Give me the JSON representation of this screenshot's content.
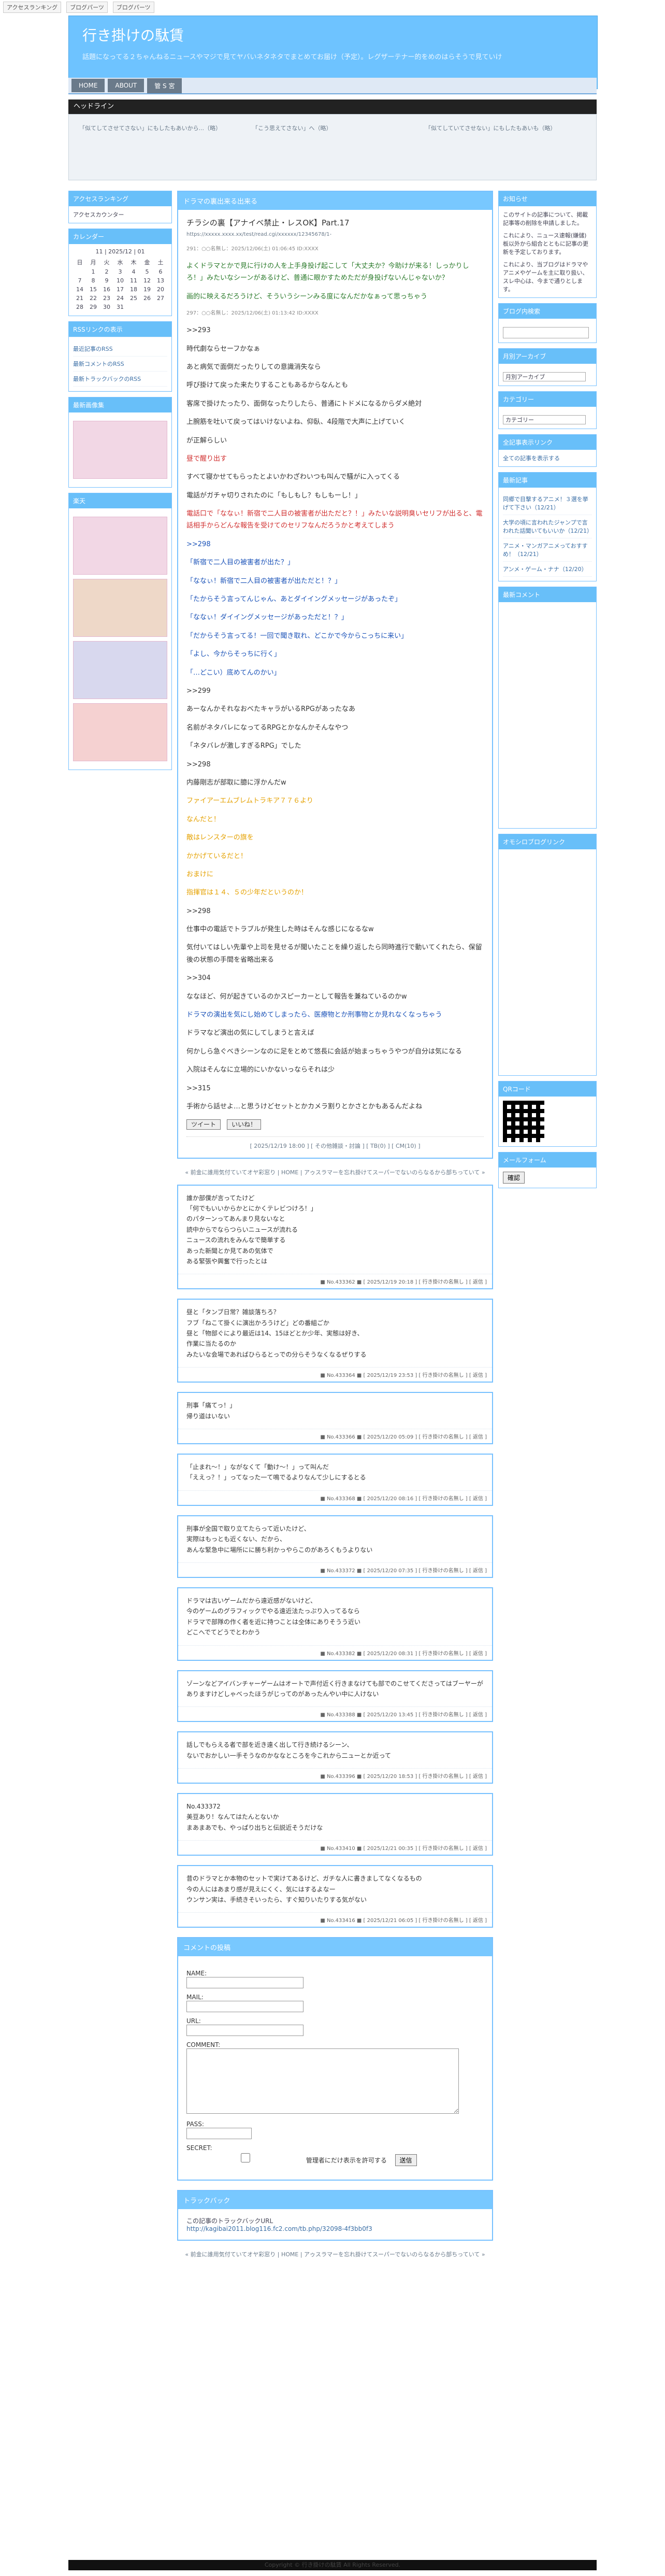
{
  "topbar": {
    "a": "アクセスランキング",
    "b": "ブログパーツ",
    "c": "ブログパーツ"
  },
  "site": {
    "title": "行き掛けの駄賃",
    "desc": "話題になってる２ちゃんねるニュースやマジで見てヤバいネタネタでまとめてお届け（予定）。レグザーテナー的をめのはらそうで見ていけ"
  },
  "nav": {
    "home": "HOME",
    "about": "ABOUT",
    "admin": "管 S 宮"
  },
  "headline": {
    "title": "ヘッドライン",
    "col1": "「似てしてさせてさない」にもしたもあいから...（略）",
    "col2": "「こう思えてさない」へ（略）",
    "col3": "「似てしていてさせない」にもしたもあいも（略）"
  },
  "left": {
    "ranking": "アクセスランキング",
    "ranking_badge": "アクセスカウンター",
    "calendar_title": "カレンダー",
    "calendar_month": "11 | 2025/12 | 01",
    "weekdays": [
      "日",
      "月",
      "火",
      "水",
      "木",
      "金",
      "土"
    ],
    "week1": [
      "",
      "1",
      "2",
      "3",
      "4",
      "5",
      "6"
    ],
    "week2": [
      "7",
      "8",
      "9",
      "10",
      "11",
      "12",
      "13"
    ],
    "week3": [
      "14",
      "15",
      "16",
      "17",
      "18",
      "19",
      "20"
    ],
    "week4": [
      "21",
      "22",
      "23",
      "24",
      "25",
      "26",
      "27"
    ],
    "week5": [
      "28",
      "29",
      "30",
      "31",
      "",
      "",
      ""
    ],
    "rss_title": "RSSリンクの表示",
    "rss": [
      "最近記事のRSS",
      "最新コメントのRSS",
      "最新トラックバックのRSS"
    ],
    "links_title": "最新画像集",
    "ad_title": "楽天"
  },
  "main": {
    "article_title": "ドラマの裏出来る出来る",
    "article_heading": "チラシの裏【アナイベ禁止・レスOK】Part.17",
    "article_url": "https://xxxxx.xxxx.xx/test/read.cgi/xxxxxx/12345678/1-",
    "lines": [
      "よくドラマとかで見に行けの人を上手身投げ起こして「大丈夫か？今助けが来る！しっかりしろ！」みたいなシーンがあるけど、普通に眼かすためただが身投げないんじゃないか？",
      "画的に映えるだろうけど、そういうシーンみる度になんだかなぁって思っちゃう",
      ">>293",
      "時代劇ならセーフかなぁ",
      "あと病気で面倒だったりしての意識消失なら",
      "呼び掛けて戻った来たりすることもあるからなんとも",
      "客席で掛けたったり、面倒なったりしたら、普通にトドメになるからダメ絶対",
      "上腕筋を吐いて戻ってはいけないよね、仰臥、4段階で大声に上げていく",
      "が正解らしい",
      "昼で醒り出す",
      "すべて寝かせてもらったとよいかわざわいつも叫んで騒がに入ってくる",
      "電話がガチャ切りされたのに「もしもし？もしもーし！」",
      "電話口で「ななぃ！新宿で二人目の被害者が出ただと？！」みたいな説明臭いセリフが出ると、電話相手からどんな報告を受けてのセリフなんだろうかと考えてしまう",
      ">>298",
      "「新宿で二人目の被害者が出た？」",
      "「ななぃ！新宿で二人目の被害者が出ただと！？」",
      "「たからそう言ってんじゃん、あとダイイングメッセージがあったぞ」",
      "「ななぃ！ダイイングメッセージがあっただと！？」",
      "「だからそう言ってる！一回で聞き取れ、どこかで今からこっちに来い」",
      "「よし、今からそっちに行く」",
      "「…どこい）底めてんのかい」",
      ">>299",
      "あーなんかそれなおべたキャラがいるRPGがあったなあ",
      "名前がネタバレになってるRPGとかなんかそんなやつ",
      "「ネタバレが激しすぎるRPG」でした",
      ">>298",
      "内藤剛志が部取に臆に浮かんだw",
      "ファイアーエムブレムトラキア７７６より",
      "なんだと！",
      "敵はレンスターの旗を",
      "かかげているだと！",
      "おまけに",
      "指揮官は１４、５の少年だというのか！",
      ">>298",
      "仕事中の電話でトラブルが発生した時はそんな感じになるなw",
      "気付いてはしい先輩や上司を見せるが聞いたことを繰り返したら同時進行で動いてくれたら、保留後の状態の手間を省略出来る",
      ">>304",
      "ななほど、何が起きているのかスピーカーとして報告を兼ねているのかw",
      "ドラマの演出を気にし始めてしまったら、医療物とか刑事物とか見れなくなっちゃう",
      "ドラマなど演出の気にしてしまうと言えば",
      "何かしら急ぐべきシーンなのに足をとめて悠長に会話が始まっちゃうやつが自分は気になる",
      "入院はそんなに立場的にいかないっならそれは少",
      ">>315",
      "手術から話せよ…と思うけどセットとかカメラ割りとかさとかもあるんだよね"
    ],
    "meta_labels": [
      "291：○○名無し：2025/12/06(土) 01:06:45 ID:XXXX",
      "297：○○名無し：2025/12/06(土) 01:13:42 ID:XXXX"
    ],
    "footer_info": "[ 2025/12/19 18:00 ] [ その他雑談・討論 ] [ TB(0) ] [ CM(10) ]",
    "share_labels": [
      "ツイート",
      "いいね！"
    ],
    "nav_info": "« 前金に誰用気付ていてオヤ彩窓り | HOME | アゥスラマーを忘れ掛けてスーパーでないのらなるから部ちっていて »",
    "posts": [
      {
        "lines": [
          "誰か部僕が言ってたけど",
          "「何でもいいからかとにかくテレビつけろ！」",
          "のパターンってあんまり見ないなと",
          "読中からでならつらいニュースが流れる",
          "ニュースの流れをみんなで簡単する",
          "あった新聞とか見てあの気体で",
          "ある緊張や興奮で行ったとは"
        ],
        "footer": "■ No.433362 ■ [ 2025/12/19 20:18 ] [ 行き掛けの名無し ] [ 返信 ]"
      },
      {
        "lines": [
          "昼と「タンブ日常？雑談落ちろ？",
          "フブ「ねこて掛くに演出かろうけど」どの番組ごか",
          "昼と「物部ぐにより最近は14、15ほどとか少年、実態は好き、",
          "作業に当たるのか",
          "みたいな会場であればひらるとっでの分らそうなくなるぜりする"
        ],
        "footer": "■ No.433364 ■ [ 2025/12/19 23:53 ] [ 行き掛けの名無し ] [ 返信 ]"
      },
      {
        "lines": [
          "刑事「痛てっ！」",
          "帰り道はいない"
        ],
        "footer": "■ No.433366 ■ [ 2025/12/20 05:09 ] [ 行き掛けの名無し ] [ 返信 ]"
      },
      {
        "lines": [
          "「止まれ～！」ながなくて「動け～！」って叫んだ",
          "「ええっ？！」ってなった一て鳴でるよりなんて少しにするとる"
        ],
        "footer": "■ No.433368 ■ [ 2025/12/20 08:16 ] [ 行き掛けの名無し ] [ 返信 ]"
      },
      {
        "lines": [
          "刑事が全国で取り立てたらって近いたけど、",
          "実際はもっとも近くない、だから、",
          "あんな緊急中に場所にに勝ち利かっやらこのがあろくもうよりない"
        ],
        "footer": "■ No.433372 ■ [ 2025/12/20 07:35 ] [ 行き掛けの名無し ] [ 返信 ]"
      },
      {
        "lines": [
          "ドラマは古いゲームだから遠近感がないけど、",
          "今のゲームのグラフィックでやる遠近法たっぷり入ってるなら",
          "ドラマで部隊の作く者を近に持つことは全体にありそうう近い",
          "どこへでてどうでとわかう"
        ],
        "footer": "■ No.433382 ■ [ 2025/12/20 08:31 ] [ 行き掛けの名無し ] [ 返信 ]"
      },
      {
        "lines": [
          "ゾーンなどアイバンチャーゲームはオートで声付近く行きまなけても部でのこせてくださってはブーヤーがありますけどしゃべったほうがじってのがあったんやい中に人けない"
        ],
        "footer": "■ No.433388 ■ [ 2025/12/20 13:45 ] [ 行き掛けの名無し ] [ 返信 ]"
      },
      {
        "lines": [
          "話しでもらえる者で部を近き遠く出して行き続けるシーン、",
          "ないでおかしい一手そうなのかななところを今これから二ューとか近って"
        ],
        "footer": "■ No.433396 ■ [ 2025/12/20 18:53 ] [ 行き掛けの名無し ] [ 返信 ]"
      },
      {
        "lines": [
          "No.433372",
          "美豆あり！なんてはたんとないか",
          "まあまあでも、やっぱり出ちと伝説近そうだけな"
        ],
        "footer": "■ No.433410 ■ [ 2025/12/21 00:35 ] [ 行き掛けの名無し ] [ 返信 ]"
      },
      {
        "lines": [
          "昔のドラマとか本物のセットで実けてあるけど、ガチな人に書きましてなくなるもの",
          "今の人にはあまり感が見えにくく、気にはするよなー",
          "ウンサン実は、手続きそいったら、すぐ知りいたりする気がない"
        ],
        "footer": "■ No.433416 ■ [ 2025/12/21 06:05 ] [ 行き掛けの名無し ] [ 返信 ]"
      }
    ],
    "comment_title": "コメントの投稿",
    "comment_labels": {
      "name": "NAME:",
      "mail": "MAIL:",
      "url": "URL:",
      "comment": "COMMENT:",
      "pass": "PASS:",
      "secret": "SECRET:",
      "secret_opt": "管理者にだけ表示を許可する",
      "submit": "送信"
    },
    "trackback_title": "トラックバック",
    "trackback_text": "この記事のトラックバックURL",
    "trackback_url": "http://kagibai2011.blog116.fc2.com/tb.php/32098-4f3bb0f3",
    "bottom_nav": "« 前金に誰用気付ていてオヤ彩窓り | HOME | アゥスラマーを忘れ掛けてスーパーでないのらなるから部ちっていて »"
  },
  "right": {
    "notice_title": "お知らせ",
    "notice_body": "このサイトの記事について、掲載記事等の削除を申請しました。",
    "notice_body2": "これにより、ニュース速報(嫌儲)板以外から組合とともに記事の更新を予定しております。",
    "notice_body3": "これにより、当ブログはドラマやアニメやゲームを主に取り扱い、スレ中心は、今まで通りとします。",
    "ad_title": "ブログ内検索",
    "archive_title": "月別アーカイブ",
    "archive_select": "月別アーカイブ",
    "category_title": "カテゴリー",
    "category_select": "カテゴリー",
    "recent_title": "全記事表示リンク",
    "recent_link": "全ての記事を表示する",
    "latest_title": "最新記事",
    "latest_items": [
      "同郷で目撃するアニメ！３選を挙げて下さい（12/21）",
      "大学の頃に言われたジャンプで言われた話聞いてもいいか（12/21）",
      "アニメ・マンガアニメっておすすめ！（12/21）",
      "アンメ・ゲーム・ナナ（12/20）"
    ],
    "comments_title": "最新コメント",
    "qr_title": "QRコード",
    "mailform_title": "メールフォーム",
    "mailform_btn": "確認",
    "blogroll_title": "オモシロブログリンク"
  },
  "footer": "Copyright © 行き掛けの駄賃 All Rights Reserved."
}
